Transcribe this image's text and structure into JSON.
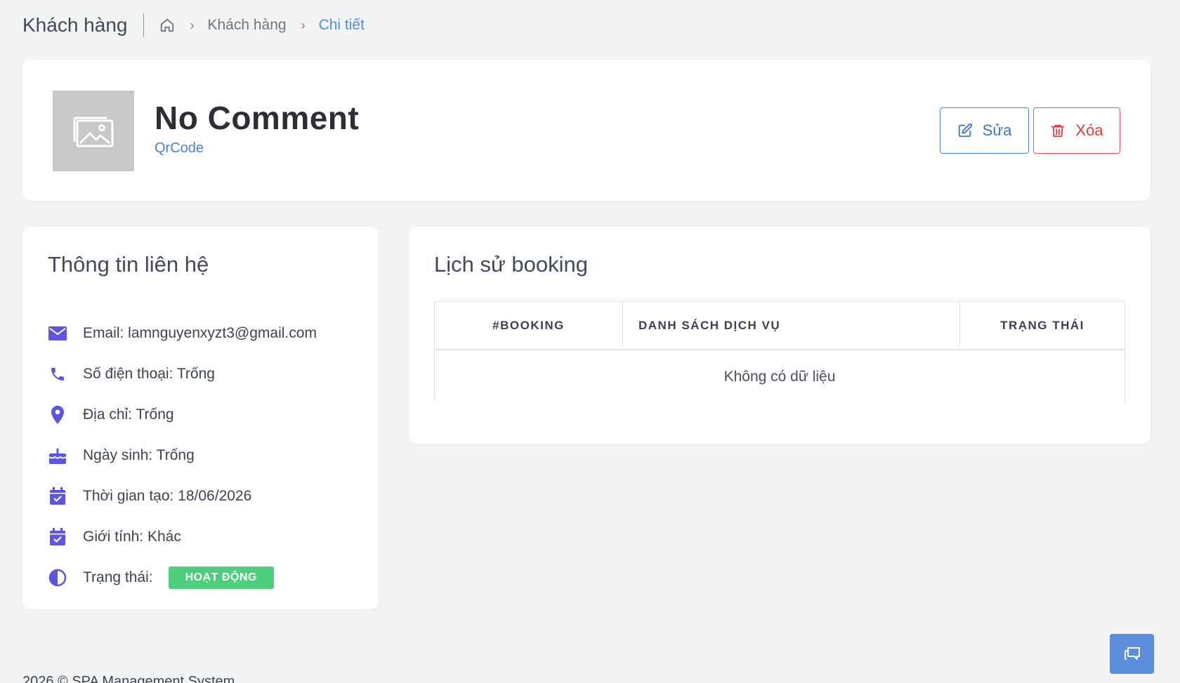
{
  "header": {
    "title": "Khách hàng",
    "breadcrumb": [
      "Khách hàng",
      "Chi tiết"
    ]
  },
  "profile": {
    "name": "No Comment",
    "sub_link": "QrCode",
    "edit_label": "Sửa",
    "delete_label": "Xóa"
  },
  "contact": {
    "title": "Thông tin liên hệ",
    "email": "Email: lamnguyenxyzt3@gmail.com",
    "phone": "Số điện thoại: Trống",
    "address": "Địa chỉ: Trống",
    "birthday": "Ngày sinh: Trống",
    "created": "Thời gian tạo: 18/06/2026",
    "gender": "Giới tính: Khác",
    "status_label": "Trạng thái:",
    "status_badge": "HOẠT ĐỘNG"
  },
  "booking": {
    "title": "Lịch sử booking",
    "columns": [
      "#BOOKING",
      "DANH SÁCH DỊCH VỤ",
      "TRẠNG THÁI"
    ],
    "empty_text": "Không có dữ liệu"
  },
  "footer": {
    "text": "2026 © SPA Management System"
  },
  "icons": {
    "home": "home-icon",
    "email": "mail-icon",
    "phone": "phone-icon",
    "address": "map-pin-icon",
    "birthday": "cake-icon",
    "created": "calendar-check-icon",
    "gender": "calendar-check-icon",
    "status": "contrast-icon",
    "edit": "edit-icon",
    "delete": "trash-icon",
    "chat": "chat-icon"
  },
  "colors": {
    "accent": "#4e8fe0",
    "primary_icon": "#5b55e0",
    "danger": "#dd3c3c",
    "success_badge": "#4cd07d"
  }
}
